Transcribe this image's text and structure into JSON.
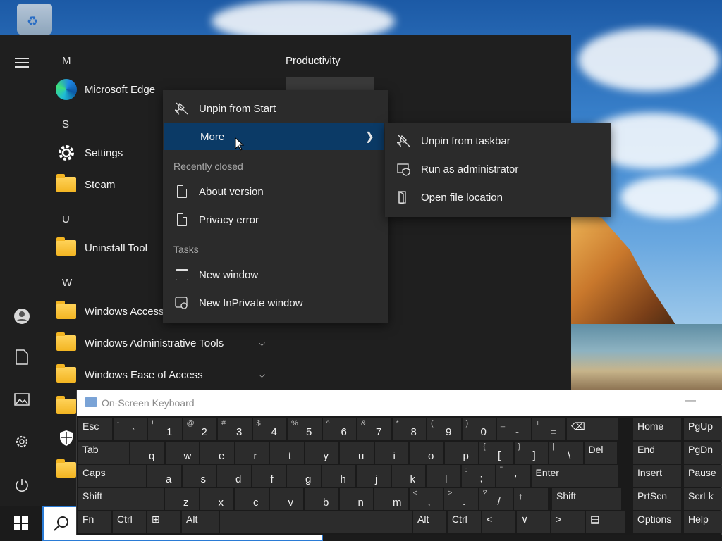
{
  "start_menu": {
    "letters": {
      "m": "M",
      "s": "S",
      "u": "U",
      "w": "W"
    },
    "apps": {
      "edge": "Microsoft Edge",
      "settings": "Settings",
      "steam": "Steam",
      "uninstall": "Uninstall Tool",
      "win_access": "Windows Access",
      "win_admin": "Windows Administrative Tools",
      "win_ease": "Windows Ease of Access"
    },
    "tiles_group": "Productivity"
  },
  "context_menu": {
    "unpin_start": "Unpin from Start",
    "more": "More",
    "recently_closed": "Recently closed",
    "about_version": "About version",
    "privacy_error": "Privacy error",
    "tasks": "Tasks",
    "new_window": "New window",
    "new_inprivate": "New InPrivate window"
  },
  "submenu": {
    "unpin_taskbar": "Unpin from taskbar",
    "run_admin": "Run as administrator",
    "open_location": "Open file location"
  },
  "keyboard": {
    "title": "On-Screen Keyboard",
    "minimize": "—",
    "row1": [
      {
        "main": "Esc"
      },
      {
        "shift": "~",
        "main": "`"
      },
      {
        "shift": "!",
        "main": "1"
      },
      {
        "shift": "@",
        "main": "2"
      },
      {
        "shift": "#",
        "main": "3"
      },
      {
        "shift": "$",
        "main": "4"
      },
      {
        "shift": "%",
        "main": "5"
      },
      {
        "shift": "^",
        "main": "6"
      },
      {
        "shift": "&",
        "main": "7"
      },
      {
        "shift": "*",
        "main": "8"
      },
      {
        "shift": "(",
        "main": "9"
      },
      {
        "shift": ")",
        "main": "0"
      },
      {
        "shift": "_",
        "main": "-"
      },
      {
        "shift": "+",
        "main": "="
      },
      {
        "main": "⌫"
      }
    ],
    "row2": [
      "Tab",
      "q",
      "w",
      "e",
      "r",
      "t",
      "y",
      "u",
      "i",
      "o",
      "p",
      {
        "shift": "{",
        "main": "["
      },
      {
        "shift": "}",
        "main": "]"
      },
      {
        "shift": "|",
        "main": "\\"
      },
      "Del"
    ],
    "row3": [
      "Caps",
      "a",
      "s",
      "d",
      "f",
      "g",
      "h",
      "j",
      "k",
      "l",
      {
        "shift": ":",
        "main": ";"
      },
      {
        "shift": "\"",
        "main": "'"
      },
      "Enter"
    ],
    "row4": [
      "Shift",
      "z",
      "x",
      "c",
      "v",
      "b",
      "n",
      "m",
      {
        "shift": "<",
        "main": ","
      },
      {
        "shift": ">",
        "main": "."
      },
      {
        "shift": "?",
        "main": "/"
      },
      "↑",
      "Shift"
    ],
    "row5": [
      "Fn",
      "Ctrl",
      "⊞",
      "Alt",
      "",
      "Alt",
      "Ctrl",
      "<",
      "∨",
      ">",
      "▤"
    ],
    "nav": [
      "Home",
      "PgUp",
      "End",
      "PgDn",
      "Insert",
      "Pause",
      "PrtScn",
      "ScrLk",
      "Options",
      "Help"
    ]
  }
}
